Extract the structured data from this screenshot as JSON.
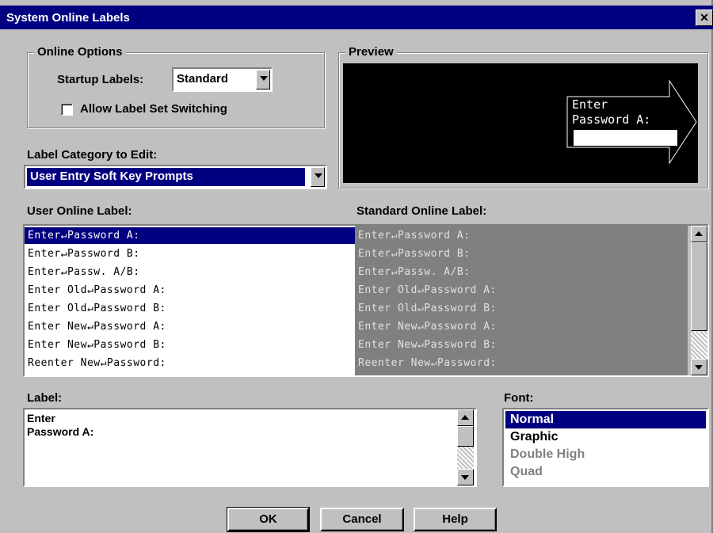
{
  "window": {
    "title": "System Online Labels",
    "close_symbol": "✕"
  },
  "online_options": {
    "group_title": "Online Options",
    "startup_labels_label": "Startup Labels:",
    "startup_labels_value": "Standard",
    "allow_switching_label": "Allow Label Set Switching",
    "allow_switching_checked": false
  },
  "preview": {
    "group_title": "Preview",
    "line1": "Enter",
    "line2": "Password A:"
  },
  "category": {
    "label": "Label Category to Edit:",
    "value": "User Entry Soft Key Prompts"
  },
  "user_labels": {
    "header": "User Online Label:",
    "items": [
      "Enter↵Password A:",
      "Enter↵Password B:",
      "Enter↵Passw. A/B:",
      "Enter Old↵Password A:",
      "Enter Old↵Password B:",
      "Enter New↵Password A:",
      "Enter New↵Password B:",
      "Reenter New↵Password:"
    ],
    "selected_index": 0
  },
  "standard_labels": {
    "header": "Standard Online Label:",
    "items": [
      "Enter↵Password A:",
      "Enter↵Password B:",
      "Enter↵Passw. A/B:",
      "Enter Old↵Password A:",
      "Enter Old↵Password B:",
      "Enter New↵Password A:",
      "Enter New↵Password B:",
      "Reenter New↵Password:"
    ]
  },
  "label_edit": {
    "header": "Label:",
    "line1": "Enter",
    "line2": "Password A:"
  },
  "font": {
    "header": "Font:",
    "options": [
      "Normal",
      "Graphic",
      "Double High",
      "Quad"
    ],
    "selected_index": 0,
    "disabled_indexes": [
      2,
      3
    ]
  },
  "buttons": {
    "ok": "OK",
    "cancel": "Cancel",
    "help": "Help"
  },
  "colors": {
    "selection": "#000080",
    "face": "#c0c0c0",
    "disabled_text": "#808080",
    "standard_list_bg": "#808080"
  }
}
